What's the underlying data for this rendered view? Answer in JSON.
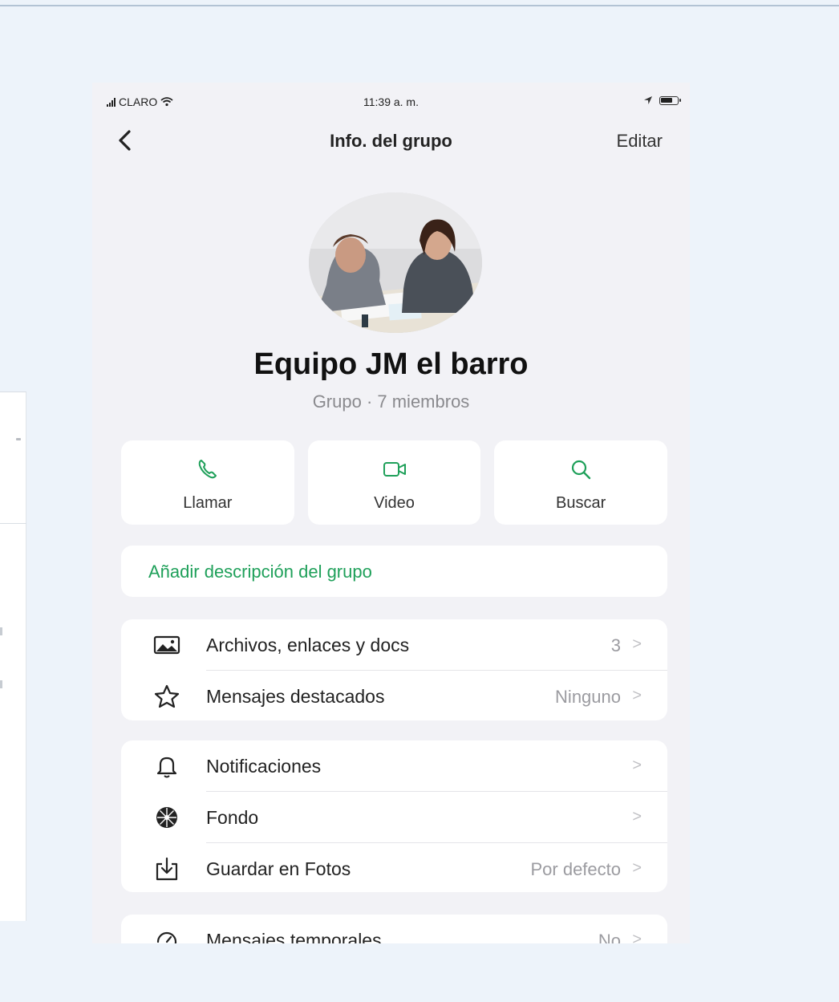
{
  "status_bar": {
    "carrier": "CLARO",
    "time": "11:39 a. m."
  },
  "nav": {
    "back_icon": "chevron-left-icon",
    "title": "Info. del grupo",
    "edit_label": "Editar"
  },
  "group": {
    "name": "Equipo JM el barro",
    "subtitle": "Grupo · 7 miembros"
  },
  "actions": [
    {
      "label": "Llamar",
      "icon": "phone-icon"
    },
    {
      "label": "Video",
      "icon": "video-icon"
    },
    {
      "label": "Buscar",
      "icon": "search-icon"
    }
  ],
  "description": {
    "label": "Añadir descripción del grupo"
  },
  "media_section": [
    {
      "label": "Archivos, enlaces y docs",
      "value": "3",
      "icon": "photo-icon"
    },
    {
      "label": "Mensajes destacados",
      "value": "Ninguno",
      "icon": "star-icon"
    }
  ],
  "settings_section": [
    {
      "label": "Notificaciones",
      "value": "",
      "icon": "bell-icon"
    },
    {
      "label": "Fondo",
      "value": "",
      "icon": "wallpaper-icon"
    },
    {
      "label": "Guardar en Fotos",
      "value": "Por defecto",
      "icon": "save-icon"
    }
  ],
  "temporary_messages": {
    "label": "Mensajes temporales",
    "value": "No",
    "icon": "timer-icon"
  },
  "chevron_glyph": ">",
  "colors": {
    "accent_green": "#1fa05a",
    "screen_background": "#f2f2f6",
    "page_background": "#edf3fa"
  }
}
